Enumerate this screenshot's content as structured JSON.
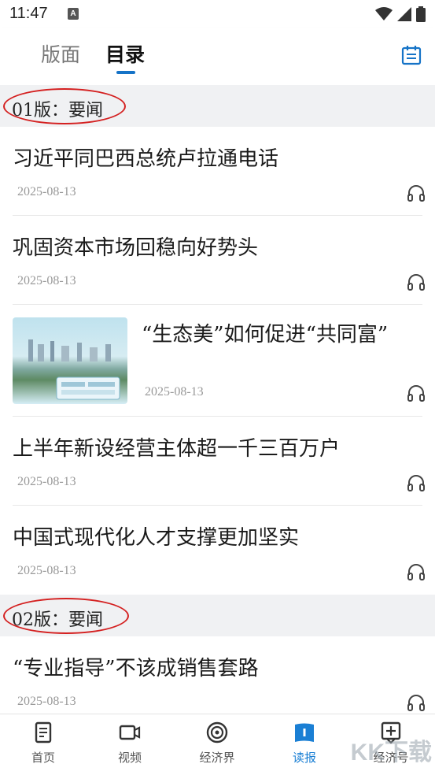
{
  "status_bar": {
    "time": "11:47",
    "notification_glyph": "A"
  },
  "header": {
    "tabs": [
      {
        "label": "版面",
        "active": false
      },
      {
        "label": "目录",
        "active": true
      }
    ],
    "accent_color": "#1573c7",
    "right_icon": "calendar-icon"
  },
  "sections": [
    {
      "label": "01版：要闻",
      "items": [
        {
          "title": "习近平同巴西总统卢拉通电话",
          "date": "2025-08-13"
        },
        {
          "title": "巩固资本市场回稳向好势头",
          "date": "2025-08-13"
        },
        {
          "title": "“生态美”如何促进“共同富”",
          "date": "2025-08-13",
          "has_image": true
        },
        {
          "title": "上半年新设经营主体超一千三百万户",
          "date": "2025-08-13"
        },
        {
          "title": "中国式现代化人才支撑更加坚实",
          "date": "2025-08-13"
        }
      ]
    },
    {
      "label": "02版：要闻",
      "items": [
        {
          "title": "“专业指导”不该成销售套路",
          "date": "2025-08-13"
        }
      ]
    }
  ],
  "bottom_nav": [
    {
      "label": "首页",
      "icon": "document-icon",
      "active": false
    },
    {
      "label": "视频",
      "icon": "video-icon",
      "active": false
    },
    {
      "label": "经济界",
      "icon": "target-icon",
      "active": false
    },
    {
      "label": "读报",
      "icon": "newspaper-icon",
      "active": true
    },
    {
      "label": "经济号",
      "icon": "add-box-icon",
      "active": false
    }
  ],
  "watermark": "KK下载",
  "annotation_color": "#d42020"
}
